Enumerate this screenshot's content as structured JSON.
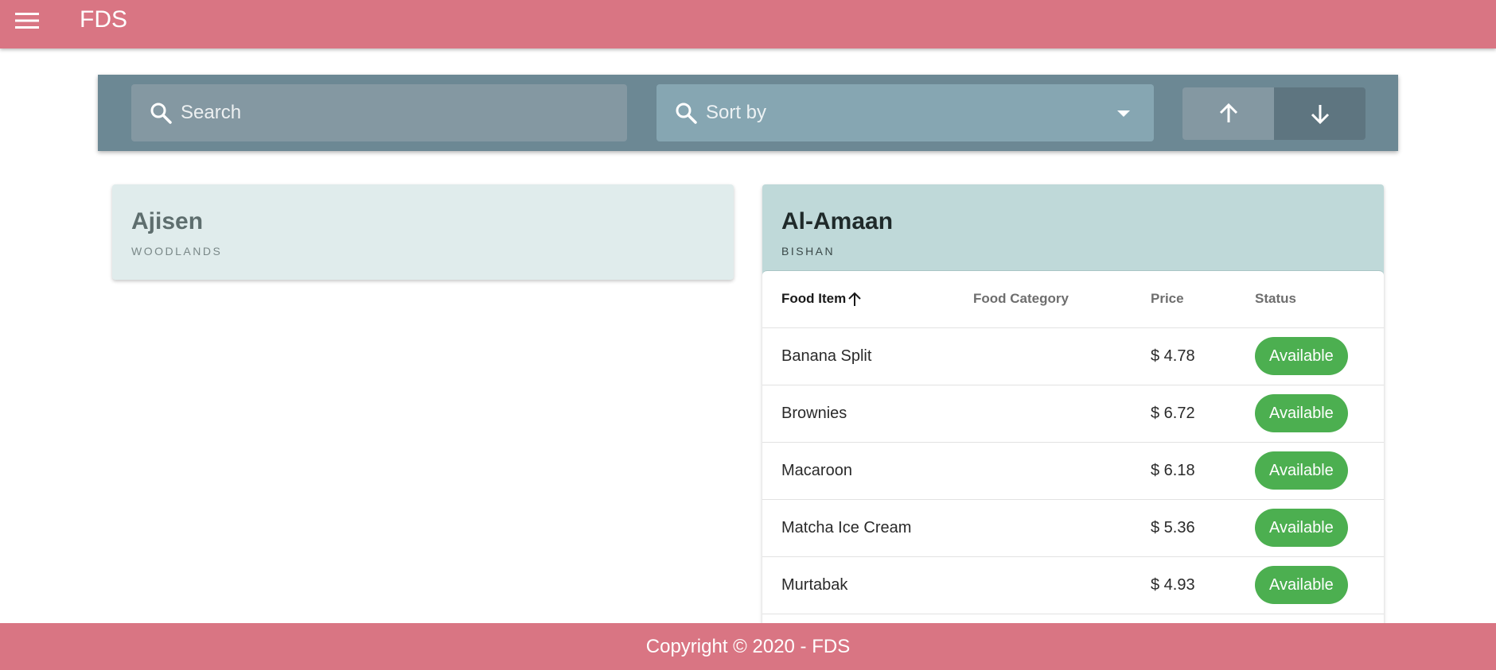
{
  "app": {
    "title": "FDS"
  },
  "toolbar": {
    "search_placeholder": "Search",
    "sort_placeholder": "Sort by"
  },
  "restaurants": [
    {
      "name": "Ajisen",
      "location": "WOODLANDS"
    },
    {
      "name": "Al-Amaan",
      "location": "BISHAN"
    }
  ],
  "menu_table": {
    "headers": [
      "Food Item",
      "Food Category",
      "Price",
      "Status"
    ],
    "rows": [
      {
        "item": "Banana Split",
        "category": "",
        "price": "$ 4.78",
        "status": "Available"
      },
      {
        "item": "Brownies",
        "category": "",
        "price": "$ 6.72",
        "status": "Available"
      },
      {
        "item": "Macaroon",
        "category": "",
        "price": "$ 6.18",
        "status": "Available"
      },
      {
        "item": "Matcha Ice Cream",
        "category": "",
        "price": "$ 5.36",
        "status": "Available"
      },
      {
        "item": "Murtabak",
        "category": "",
        "price": "$ 4.93",
        "status": "Available"
      }
    ]
  },
  "footer": {
    "text": "Copyright © 2020 - FDS"
  },
  "colors": {
    "brand": "#d97583",
    "toolbar": "#6c8894",
    "available": "#4caf50"
  }
}
